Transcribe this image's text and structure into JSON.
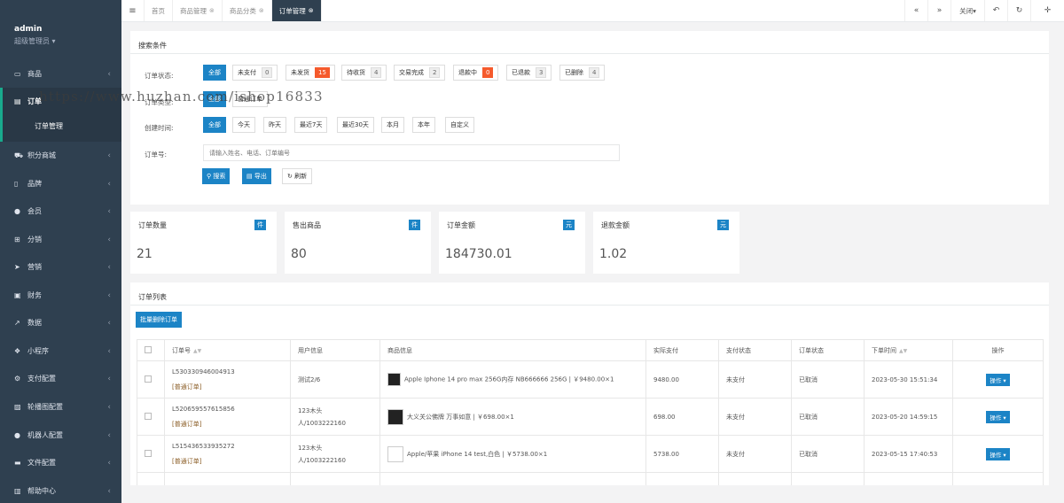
{
  "sidebar": {
    "user": "admin",
    "role": "超级管理员",
    "items": [
      {
        "icon": "monitor-icon",
        "label": "商品"
      },
      {
        "icon": "document-icon",
        "label": "订单"
      },
      {
        "icon": "cart-icon",
        "label": "积分商城"
      },
      {
        "icon": "mobile-icon",
        "label": "品牌"
      },
      {
        "icon": "user-icon",
        "label": "会员"
      },
      {
        "icon": "sitemap-icon",
        "label": "分销"
      },
      {
        "icon": "send-icon",
        "label": "营销"
      },
      {
        "icon": "money-icon",
        "label": "财务"
      },
      {
        "icon": "chart-icon",
        "label": "数据"
      },
      {
        "icon": "cubes-icon",
        "label": "小程序"
      },
      {
        "icon": "cogs-icon",
        "label": "支付配置"
      },
      {
        "icon": "image-icon",
        "label": "轮播图配置"
      },
      {
        "icon": "robot-icon",
        "label": "机器人配置"
      },
      {
        "icon": "folder-icon",
        "label": "文件配置"
      },
      {
        "icon": "book-icon",
        "label": "帮助中心"
      }
    ],
    "sub_item": "订单管理"
  },
  "tabs": [
    {
      "label": "首页",
      "closable": false
    },
    {
      "label": "商品管理",
      "closable": true
    },
    {
      "label": "商品分类",
      "closable": true
    },
    {
      "label": "订单管理",
      "closable": true
    }
  ],
  "tabbar_right": {
    "close_label": "关闭"
  },
  "watermark": "https://www.huzhan.com/ishop16833",
  "search": {
    "title": "搜索条件",
    "status_label": "订单状态:",
    "status_options": [
      {
        "label": "全部"
      },
      {
        "label": "未支付",
        "count": "0"
      },
      {
        "label": "未发货",
        "count": "15",
        "highlight": true
      },
      {
        "label": "待收货",
        "count": "4"
      },
      {
        "label": "交易完成",
        "count": "2"
      },
      {
        "label": "退款中",
        "count": "0",
        "highlight": true
      },
      {
        "label": "已退款",
        "count": "3"
      },
      {
        "label": "已删除",
        "count": "4"
      }
    ],
    "type_label": "订单类型:",
    "type_options": [
      "全部",
      "普通订单"
    ],
    "time_label": "创建时间:",
    "time_options": [
      "全部",
      "今天",
      "昨天",
      "最近7天",
      "最近30天",
      "本月",
      "本年",
      "自定义"
    ],
    "order_no_label": "订单号:",
    "placeholder": "请输入姓名、电话、订单编号",
    "btn_search": "搜索",
    "btn_export": "导出",
    "btn_refresh": "刷新"
  },
  "stats": [
    {
      "title": "订单数量",
      "badge": "件",
      "value": "21"
    },
    {
      "title": "售出商品",
      "badge": "件",
      "value": "80"
    },
    {
      "title": "订单金额",
      "badge": "元",
      "value": "184730.01"
    },
    {
      "title": "退款金额",
      "badge": "元",
      "value": "1.02"
    }
  ],
  "list": {
    "title": "订单列表",
    "batch_delete": "批量删除订单",
    "columns": [
      "订单号",
      "用户信息",
      "商品信息",
      "实际支付",
      "支付状态",
      "订单状态",
      "下单时间",
      "操作"
    ],
    "rows": [
      {
        "order_no": "L530330946004913",
        "tag": "[普通订单]",
        "user": "测试2/6",
        "product": "Apple Iphone 14 pro max 256G内存 NB666666 256G | ￥9480.00×1",
        "paid": "9480.00",
        "pay_status": "未支付",
        "order_status": "已取消",
        "time": "2023-05-30 15:51:34",
        "op": "操作"
      },
      {
        "order_no": "L520659557615856",
        "tag": "[普通订单]",
        "user": "123木头人/1003222160",
        "product": "大义关公佛牌 万事如意 | ￥698.00×1",
        "paid": "698.00",
        "pay_status": "未支付",
        "order_status": "已取消",
        "time": "2023-05-20 14:59:15",
        "op": "操作"
      },
      {
        "order_no": "L515436533935272",
        "tag": "[普通订单]",
        "user": "123木头人/1003222160",
        "product": "Apple/苹果 iPhone 14 test,白色 | ￥5738.00×1",
        "paid": "5738.00",
        "pay_status": "未支付",
        "order_status": "已取消",
        "time": "2023-05-15 17:40:53",
        "op": "操作"
      }
    ]
  },
  "colors": {
    "sidebar_bg": "#2f4050",
    "primary": "#1c84c6",
    "badge_red": "#f55a2c",
    "active_tab": "#2f4050"
  }
}
